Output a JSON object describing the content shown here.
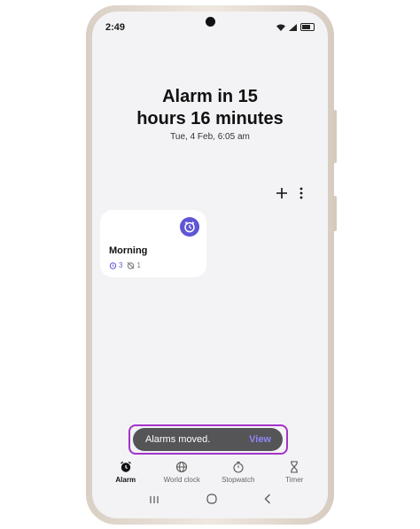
{
  "status_bar": {
    "time": "2:49"
  },
  "header": {
    "line1": "Alarm in 15",
    "line2": "hours 16 minutes",
    "date": "Tue, 4 Feb, 6:05 am"
  },
  "toolbar": {
    "add_icon": "plus-icon",
    "more_icon": "more-vert-icon"
  },
  "alarm_card": {
    "name": "Morning",
    "count_alarms": "3",
    "count_off": "1",
    "accent": "#5f55d6"
  },
  "toast": {
    "message": "Alarms moved.",
    "action": "View",
    "highlight_color": "#a333c8"
  },
  "tabs": [
    {
      "label": "Alarm",
      "icon": "alarm-icon",
      "active": true
    },
    {
      "label": "World clock",
      "icon": "globe-icon",
      "active": false
    },
    {
      "label": "Stopwatch",
      "icon": "stopwatch-icon",
      "active": false
    },
    {
      "label": "Timer",
      "icon": "hourglass-icon",
      "active": false
    }
  ],
  "nav": {
    "recents": "recents-icon",
    "home": "home-icon",
    "back": "back-icon"
  }
}
